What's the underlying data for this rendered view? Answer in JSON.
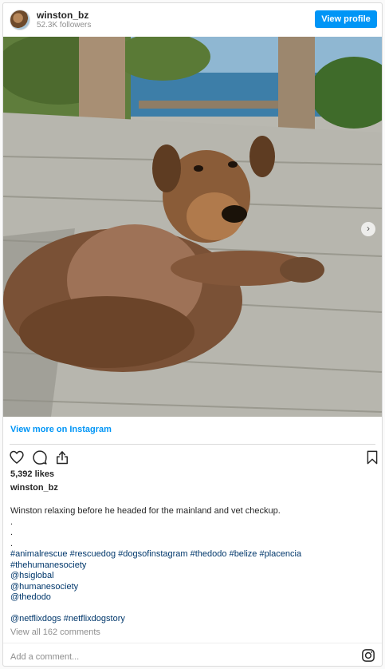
{
  "header": {
    "username": "winston_bz",
    "followers": "52.3K followers",
    "view_profile": "View profile"
  },
  "post": {
    "view_more": "View more on Instagram",
    "likes": "5,392 likes",
    "owner": "winston_bz",
    "caption_lines": [
      "Winston relaxing before he headed for the mainland and vet checkup.",
      ".",
      ".",
      ".",
      "#animalrescue #rescuedog #dogsofinstagram #thedodo #belize #placencia",
      "#thehumanesociety",
      "@hsiglobal",
      "@humanesociety",
      "@thedodo",
      "",
      "@netflixdogs #netflixdogstory"
    ],
    "comments": "View all 162 comments",
    "add_comment": "Add a comment..."
  },
  "icons": {
    "avatar": "avatar",
    "like": "heart-icon",
    "comment": "comment-icon",
    "share": "share-icon",
    "save": "bookmark-icon",
    "next": "chevron-right-icon",
    "instagram": "instagram-icon"
  },
  "colors": {
    "accent": "#0095f6",
    "hashtag": "#00376b",
    "muted": "#8e8e8e"
  }
}
